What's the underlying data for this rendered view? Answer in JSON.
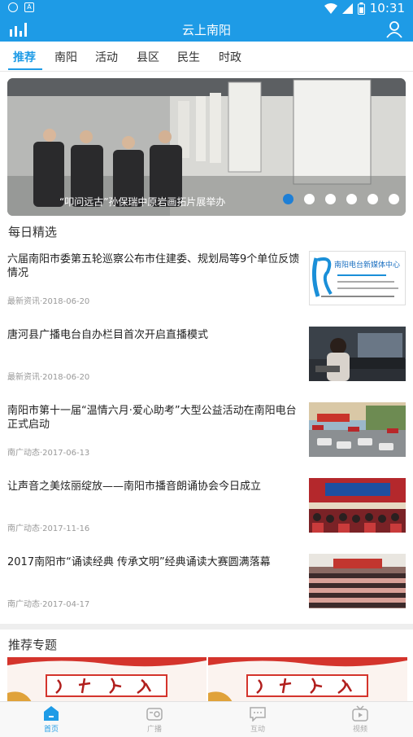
{
  "status_bar": {
    "time": "10:31"
  },
  "app": {
    "title": "云上南阳"
  },
  "tabs": [
    "推荐",
    "南阳",
    "活动",
    "县区",
    "民生",
    "时政"
  ],
  "banner": {
    "caption": "“叩问远古”孙保瑞中原岩画拓片展举办",
    "slide_count": 6,
    "active_index": 0
  },
  "daily": {
    "title": "每日精选",
    "items": [
      {
        "headline": "六届南阳市委第五轮巡察公布市住建委、规划局等9个单位反馈情况",
        "meta": "最新资讯·2018-06-20",
        "thumb_text": "南阳电台新媒体中心"
      },
      {
        "headline": "唐河县广播电台自办栏目首次开启直播模式",
        "meta": "最新资讯·2018-06-20"
      },
      {
        "headline": "南阳市第十一届“温情六月·爱心助考”大型公益活动在南阳电台正式启动",
        "meta": "南广动态·2017-06-13"
      },
      {
        "headline": "让声音之美炫丽绽放——南阳市播音朗诵协会今日成立",
        "meta": "南广动态·2017-11-16"
      },
      {
        "headline": "2017南阳市“诵读经典 传承文明”经典诵读大赛圆满落幕",
        "meta": "南广动态·2017-04-17"
      }
    ]
  },
  "topics": {
    "title": "推荐专题"
  },
  "bottom_nav": [
    "首页",
    "广播",
    "互动",
    "视频"
  ],
  "colors": {
    "accent": "#1e9be6",
    "tab_text": "#333333",
    "meta_text": "#999999"
  }
}
